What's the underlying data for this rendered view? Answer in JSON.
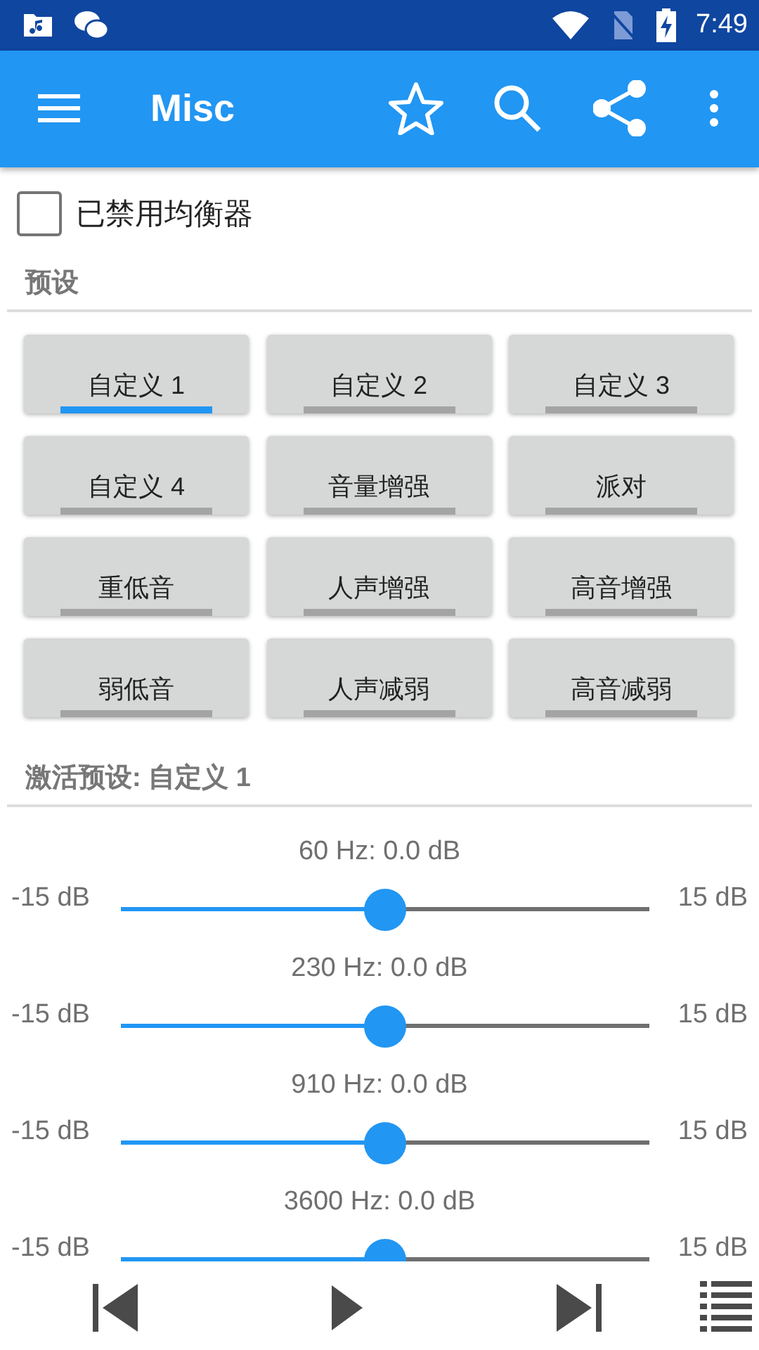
{
  "status_bar": {
    "time": "7:49"
  },
  "toolbar": {
    "title": "Misc"
  },
  "equalizer_toggle": {
    "label": "已禁用均衡器",
    "checked": false
  },
  "presets": {
    "heading": "预设",
    "items": [
      {
        "label": "自定义 1",
        "selected": true
      },
      {
        "label": "自定义 2",
        "selected": false
      },
      {
        "label": "自定义 3",
        "selected": false
      },
      {
        "label": "自定义 4",
        "selected": false
      },
      {
        "label": "音量增强",
        "selected": false
      },
      {
        "label": "派对",
        "selected": false
      },
      {
        "label": "重低音",
        "selected": false
      },
      {
        "label": "人声增强",
        "selected": false
      },
      {
        "label": "高音增强",
        "selected": false
      },
      {
        "label": "弱低音",
        "selected": false
      },
      {
        "label": "人声减弱",
        "selected": false
      },
      {
        "label": "高音减弱",
        "selected": false
      }
    ]
  },
  "active_preset": "激活预设: 自定义 1",
  "bands": [
    {
      "label": "60 Hz: 0.0 dB",
      "min": "-15 dB",
      "max": "15 dB",
      "level": 0.5
    },
    {
      "label": "230 Hz: 0.0 dB",
      "min": "-15 dB",
      "max": "15 dB",
      "level": 0.5
    },
    {
      "label": "910 Hz: 0.0 dB",
      "min": "-15 dB",
      "max": "15 dB",
      "level": 0.5
    },
    {
      "label": "3600 Hz: 0.0 dB",
      "min": "-15 dB",
      "max": "15 dB",
      "level": 0.5
    }
  ]
}
